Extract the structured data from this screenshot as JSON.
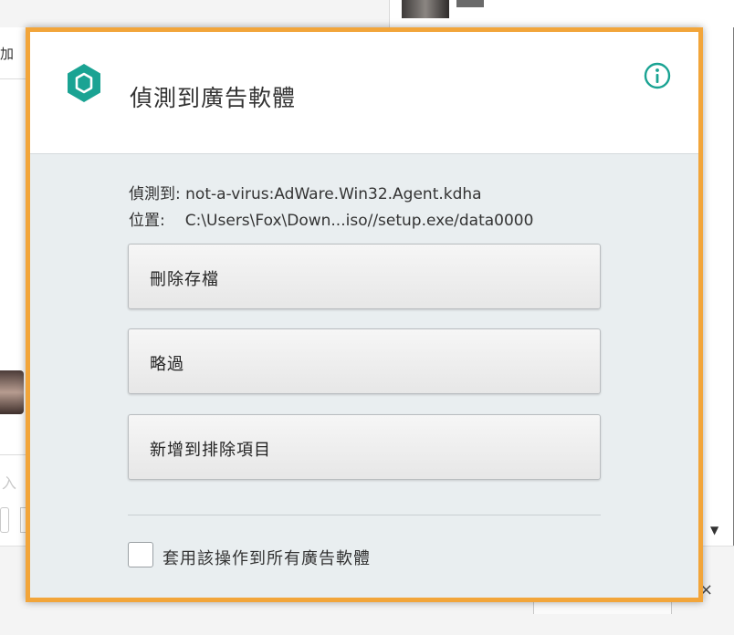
{
  "background": {
    "left_fragment_text": "加",
    "left_ghost_text": "入"
  },
  "dialog": {
    "title": "偵測到廣告軟體",
    "shield_icon": "shield-icon",
    "info_icon": "info-icon",
    "accent_color": "#f2a53a",
    "brand_color": "#1aa393",
    "detected_label": "偵測到:",
    "detected_value": "not-a-virus:AdWare.Win32.Agent.kdha",
    "location_label": "位置:",
    "location_value": "C:\\Users\\Fox\\Down...iso//setup.exe/data0000",
    "actions": {
      "delete_label": "刪除存檔",
      "skip_label": "略過",
      "exclude_label": "新增到排除項目"
    },
    "apply_all": {
      "label": "套用該操作到所有廣告軟體",
      "checked": false
    }
  }
}
